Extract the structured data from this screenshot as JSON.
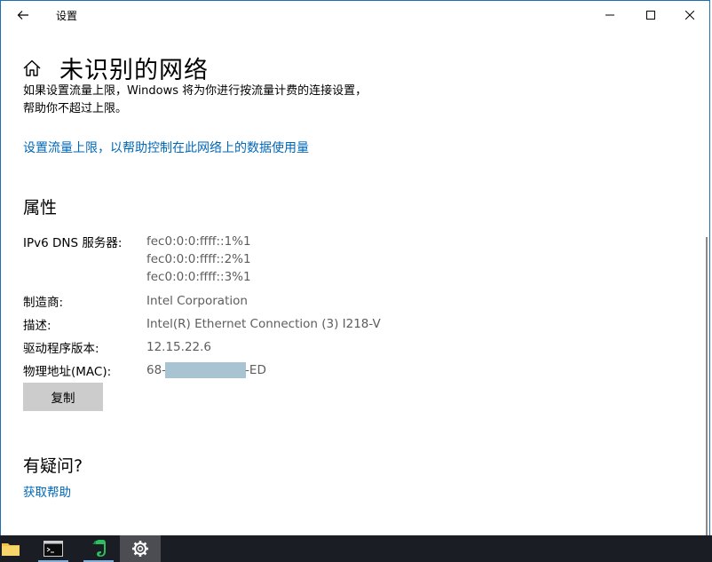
{
  "window": {
    "title": "设置",
    "icons": {
      "back": "back-arrow-icon",
      "minimize": "minimize-icon",
      "maximize": "maximize-icon",
      "close": "close-icon"
    }
  },
  "page": {
    "title": "未识别的网络",
    "description_line1": "如果设置流量上限，Windows 将为你进行按流量计费的连接设置，",
    "description_line2": "帮助你不超过上限。",
    "limit_link": "设置流量上限，以帮助控制在此网络上的数据使用量"
  },
  "properties": {
    "heading": "属性",
    "ipv6_dns_label": "IPv6 DNS 服务器:",
    "ipv6_dns_values": [
      "fec0:0:0:ffff::1%1",
      "fec0:0:0:ffff::2%1",
      "fec0:0:0:ffff::3%1"
    ],
    "manufacturer_label": "制造商:",
    "manufacturer_value": "Intel Corporation",
    "description_label": "描述:",
    "description_value": "Intel(R) Ethernet Connection (3) I218-V",
    "driver_label": "驱动程序版本:",
    "driver_value": "12.15.22.6",
    "mac_label": "物理地址(MAC):",
    "mac_prefix": "68-",
    "mac_suffix": "-ED",
    "copy_button": "复制"
  },
  "help": {
    "heading": "有疑问?",
    "link": "获取帮助"
  },
  "taskbar": {
    "items": [
      "file-explorer-icon",
      "command-prompt-icon",
      "evernote-icon",
      "settings-gear-icon"
    ]
  },
  "colors": {
    "accent_link": "#0067b8",
    "button_bg": "#cccccc",
    "taskbar_bg": "#1a1d24",
    "mask": "#a8c3d1"
  }
}
